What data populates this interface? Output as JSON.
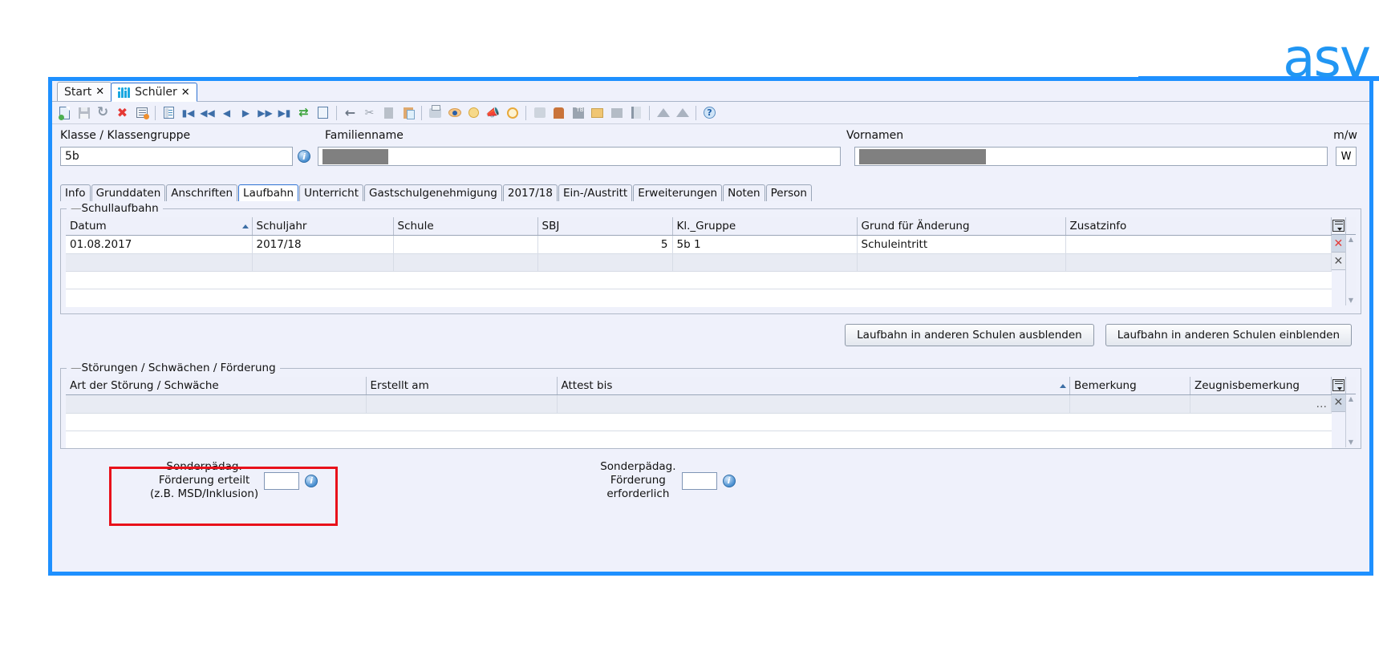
{
  "brand": {
    "logo_text": "asv"
  },
  "window_tabs": [
    {
      "label": "Start",
      "close": "✕",
      "icon": null,
      "active": false
    },
    {
      "label": "Schüler",
      "close": "✕",
      "icon": "students-icon",
      "active": true
    }
  ],
  "toolbar": {
    "groups": [
      [
        "new-document-icon",
        "save-icon",
        "undo-icon",
        "delete-icon",
        "edit-form-icon"
      ],
      [
        "record-card-icon",
        "first-record-icon",
        "prev-page-icon",
        "prev-record-icon",
        "next-record-icon",
        "next-page-icon",
        "last-record-icon",
        "refresh-icon",
        "list-icon"
      ],
      [
        "back-arrow-icon",
        "cut-icon",
        "copy-icon",
        "paste-icon"
      ],
      [
        "print-icon",
        "preview-icon",
        "bulb-icon",
        "megaphone-icon",
        "clock-icon"
      ],
      [
        "group-icon",
        "person-icon",
        "tb-icon",
        "folder-icon",
        "dark-icon",
        "address-book-icon"
      ],
      [
        "cone-icon",
        "cone2-icon"
      ],
      [
        "help-icon"
      ]
    ]
  },
  "header": {
    "klasse_label": "Klasse / Klassengruppe",
    "klasse_value": "5b",
    "familienname_label": "Familienname",
    "familienname_value": "",
    "vornamen_label": "Vornamen",
    "vornamen_value": "",
    "mw_label": "m/w",
    "mw_value": "W"
  },
  "inner_tabs": [
    {
      "label": "Info",
      "active": false
    },
    {
      "label": "Grunddaten",
      "active": false
    },
    {
      "label": "Anschriften",
      "active": false
    },
    {
      "label": "Laufbahn",
      "active": true
    },
    {
      "label": "Unterricht",
      "active": false
    },
    {
      "label": "Gastschulgenehmigung",
      "active": false
    },
    {
      "label": "2017/18",
      "active": false
    },
    {
      "label": "Ein-/Austritt",
      "active": false
    },
    {
      "label": "Erweiterungen",
      "active": false
    },
    {
      "label": "Noten",
      "active": false
    },
    {
      "label": "Person",
      "active": false
    }
  ],
  "schullaufbahn": {
    "title": "Schullaufbahn",
    "columns": [
      {
        "label": "Datum",
        "sorted": true
      },
      {
        "label": "Schuljahr",
        "sorted": false
      },
      {
        "label": "Schule",
        "sorted": false
      },
      {
        "label": "SBJ",
        "sorted": false
      },
      {
        "label": "Kl._Gruppe",
        "sorted": false
      },
      {
        "label": "Grund für Änderung",
        "sorted": false
      },
      {
        "label": "Zusatzinfo",
        "sorted": false
      }
    ],
    "rows": [
      {
        "datum": "01.08.2017",
        "schuljahr": "2017/18",
        "schule": "",
        "sbj": "5",
        "kl_gruppe": "5b 1",
        "grund": "Schuleintritt",
        "zusatzinfo": "",
        "delete": "✕"
      },
      {
        "datum": "",
        "schuljahr": "",
        "schule": "",
        "sbj": "",
        "kl_gruppe": "",
        "grund": "",
        "zusatzinfo": "",
        "delete": "✕"
      }
    ],
    "config_icon": "column-config-icon"
  },
  "buttons": {
    "hide_label": "Laufbahn in anderen Schulen ausblenden",
    "show_label": "Laufbahn in anderen Schulen einblenden"
  },
  "stoerungen": {
    "title": "Störungen / Schwächen / Förderung",
    "columns": [
      {
        "label": "Art der Störung / Schwäche",
        "sorted": false
      },
      {
        "label": "Erstellt am",
        "sorted": false
      },
      {
        "label": "Attest bis",
        "sorted": true
      },
      {
        "label": "Bemerkung",
        "sorted": false
      },
      {
        "label": "Zeugnisbemerkung",
        "sorted": false
      }
    ],
    "rows": [
      {
        "art": "",
        "erstellt": "",
        "attest": "",
        "bemerkung": "",
        "zeugnis": "",
        "ellipsis": "…",
        "delete": "✕"
      }
    ],
    "config_icon": "column-config-icon"
  },
  "foerderung": {
    "erteilt_label_line1": "Sonderpädag.",
    "erteilt_label_line2": "Förderung erteilt",
    "erteilt_label_line3": "(z.B. MSD/Inklusion)",
    "erteilt_value": "",
    "erforderlich_label_line1": "Sonderpädag.",
    "erforderlich_label_line2": "Förderung",
    "erforderlich_label_line3": "erforderlich",
    "erforderlich_value": ""
  },
  "annotation": {
    "highlight_color": "#e8111a"
  }
}
